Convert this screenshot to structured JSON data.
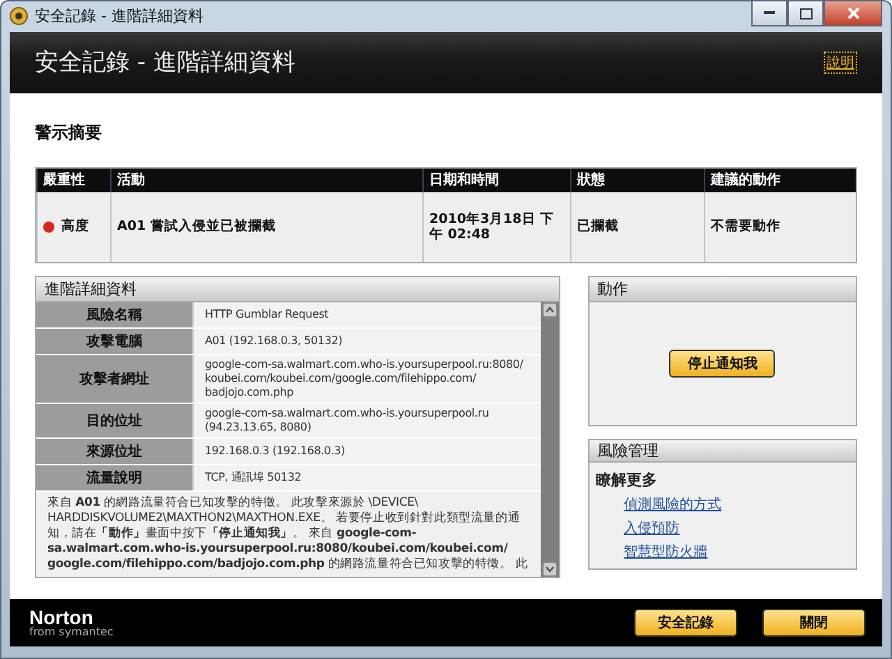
{
  "window": {
    "title": "安全記錄 - 進階詳細資料"
  },
  "header": {
    "title": "安全記錄 - 進階詳細資料",
    "help_link": "說明"
  },
  "summary": {
    "title": "警示摘要",
    "columns": [
      "嚴重性",
      "活動",
      "日期和時間",
      "狀態",
      "建議的動作"
    ],
    "rows": [
      {
        "severity": "高度",
        "color": "#d9261c",
        "activity": "A01 嘗試入侵並已被攔截",
        "datetime": "2010年3月18日 下午 02:48",
        "status": "已攔截",
        "recommended_action": "不需要動作"
      }
    ]
  },
  "details": {
    "title": "進階詳細資料",
    "rows": [
      {
        "label": "風險名稱",
        "value": "HTTP Gumblar Request"
      },
      {
        "label": "攻擊電腦",
        "value": "A01 (192.168.0.3, 50132)"
      },
      {
        "label": "攻擊者網址",
        "value": "google-com-sa.walmart.com.who-is.yoursuperpool.ru:8080/ koubei.com/koubei.com/google.com/filehippo.com/ badjojo.com.php"
      },
      {
        "label": "目的位址",
        "value": "google-com-sa.walmart.com.who-is.yoursuperpool.ru (94.23.13.65, 8080)"
      },
      {
        "label": "來源位址",
        "value": "192.168.0.3 (192.168.0.3)"
      },
      {
        "label": "流量說明",
        "value": "TCP, 通訊埠 50132"
      }
    ],
    "description": "來自 **A01** 的網路流量符合已知攻擊的特徵。 此攻擊來源於 \\DEVICE\\ HARDDISKVOLUME2\\MAXTHON2\\MAXTHON.EXE。 若要停止收到針對此類型流量的通知，請在**「動作」**畫面中按下**「停止通知我」**。 來自 **google-com-sa.walmart.com.who-is.yoursuperpool.ru:8080/koubei.com/koubei.com/ google.com/filehippo.com/badjojo.com.php** 的網路流量符合已知攻擊的特徵。 此"
  },
  "actions": {
    "title": "動作",
    "button": "停止通知我"
  },
  "risk_management": {
    "title": "風險管理",
    "subtitle": "瞭解更多",
    "links": [
      "偵測風險的方式",
      "入侵預防",
      "智慧型防火牆"
    ]
  },
  "footer": {
    "logo": "Norton",
    "logo_sub": "from symantec",
    "buttons": [
      "安全記錄",
      "關閉"
    ]
  }
}
